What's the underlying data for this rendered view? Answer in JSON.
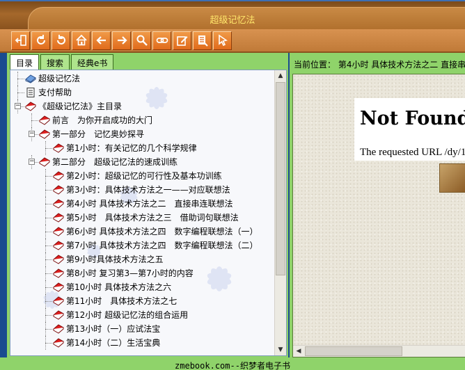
{
  "window": {
    "title": "超级记忆法"
  },
  "toolbar": {
    "buttons": [
      {
        "icon": "exit-icon"
      },
      {
        "icon": "refresh-icon"
      },
      {
        "icon": "rotate-back-icon"
      },
      {
        "icon": "home-icon"
      },
      {
        "icon": "arrow-left-icon"
      },
      {
        "icon": "arrow-right-icon"
      },
      {
        "icon": "search-icon"
      },
      {
        "icon": "links-icon"
      },
      {
        "icon": "edit-icon"
      },
      {
        "icon": "notes-icon"
      },
      {
        "icon": "pointer-icon"
      }
    ]
  },
  "left": {
    "tabs": [
      "目录",
      "搜索",
      "经典e书"
    ],
    "tree": [
      {
        "label": "超级记忆法",
        "level": 0,
        "icon": "book-blue-icon"
      },
      {
        "label": "支付帮助",
        "level": 0,
        "icon": "document-icon"
      },
      {
        "label": "《超级记忆法》主目录",
        "level": 0,
        "icon": "book-red-icon",
        "expander": "−"
      },
      {
        "label": "前言　为你开启成功的大门",
        "level": 1,
        "icon": "book-red-icon"
      },
      {
        "label": "第一部分　记忆奥妙探寻",
        "level": 1,
        "icon": "book-red-icon",
        "expander": "−"
      },
      {
        "label": "第1小时：有关记忆的几个科学规律",
        "level": 2,
        "icon": "book-red-icon"
      },
      {
        "label": "第二部分　超级记忆法的速成训练",
        "level": 1,
        "icon": "book-red-icon",
        "expander": "−"
      },
      {
        "label": "第2小时：超级记忆的可行性及基本功训练",
        "level": 2,
        "icon": "book-red-icon"
      },
      {
        "label": "第3小时：具体技术方法之一——对应联想法",
        "level": 2,
        "icon": "book-red-icon"
      },
      {
        "label": "第4小时 具体技术方法之二　直接串连联想法",
        "level": 2,
        "icon": "book-red-icon"
      },
      {
        "label": "第5小时　具体技术方法之三　借助词句联想法",
        "level": 2,
        "icon": "book-red-icon"
      },
      {
        "label": "第6小时 具体技术方法之四　数字编程联想法（一）",
        "level": 2,
        "icon": "book-red-icon"
      },
      {
        "label": "第7小时 具体技术方法之四　数字编程联想法（二）",
        "level": 2,
        "icon": "book-red-icon"
      },
      {
        "label": "第9小时具体技术方法之五",
        "level": 2,
        "icon": "book-red-icon"
      },
      {
        "label": "第8小时 复习第3—第7小时的内容",
        "level": 2,
        "icon": "book-red-icon"
      },
      {
        "label": "第10小时 具体技术方法之六",
        "level": 2,
        "icon": "book-red-icon"
      },
      {
        "label": "第11小时　具体技术方法之七",
        "level": 2,
        "icon": "book-red-icon"
      },
      {
        "label": "第12小时 超级记忆法的组合运用",
        "level": 2,
        "icon": "book-red-icon"
      },
      {
        "label": "第13小时（一）应试法宝",
        "level": 2,
        "icon": "book-red-icon"
      },
      {
        "label": "第14小时（二）生活宝典",
        "level": 2,
        "icon": "book-red-icon"
      }
    ]
  },
  "right": {
    "location": "当前位置：  第4小时  具体技术方法之二   直接串",
    "page": {
      "title": "Not Found",
      "text": "The requested URL /dy/1"
    }
  },
  "status": {
    "text": "zmebook.com--织梦者电子书"
  },
  "colors": {
    "panel_green": "#8fd36a",
    "titlebar_brown": "#a5682b",
    "title_yellow": "#ffe66b",
    "toolbar_orange": "#e06b1c",
    "frame_blue": "#1a4b8f"
  }
}
